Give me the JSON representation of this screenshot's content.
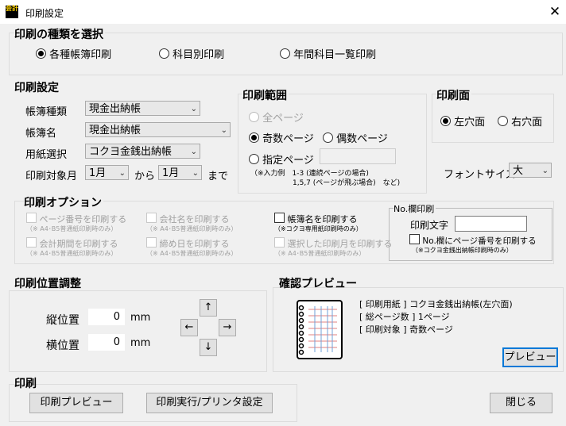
{
  "window": {
    "title": "印刷設定",
    "close": "✕",
    "icon_text": "会計"
  },
  "print_type": {
    "header": "印刷の種類を選択",
    "options": [
      "各種帳簿印刷",
      "科目別印刷",
      "年間科目一覧印刷"
    ],
    "selected": 0
  },
  "settings": {
    "header": "印刷設定",
    "ledger_type_label": "帳簿種類",
    "ledger_type_value": "現金出納帳",
    "ledger_name_label": "帳簿名",
    "ledger_name_value": "現金出納帳",
    "paper_label": "用紙選択",
    "paper_value": "コクヨ金銭出納帳",
    "month_label": "印刷対象月",
    "month_from": "1月",
    "from_label": "から",
    "month_to": "1月",
    "to_label": "まで"
  },
  "range": {
    "header": "印刷範囲",
    "all_pages": "全ページ",
    "odd_pages": "奇数ページ",
    "even_pages": "偶数ページ",
    "specified_pages": "指定ページ",
    "example_line1": "（※入力例　1-3 (連続ページの場合)",
    "example_line2": "1,5,7 (ページが飛ぶ場合)　など)",
    "specified_value": ""
  },
  "side": {
    "header": "印刷面",
    "left": "左穴面",
    "right": "右穴面"
  },
  "font": {
    "label": "フォントサイズ",
    "value": "大"
  },
  "options": {
    "header": "印刷オプション",
    "page_number": "ページ番号を印刷する",
    "page_number_note": "（※ A4･B5普通紙印刷時のみ）",
    "company_name": "会社名を印刷する",
    "company_name_note": "（※ A4･B5普通紙印刷時のみ）",
    "ledger_name": "帳簿名を印刷する",
    "ledger_name_note": "（※コクヨ専用紙印刷時のみ）",
    "fiscal_period": "会計期間を印刷する",
    "fiscal_period_note": "（※ A4･B5普通紙印刷時のみ）",
    "closing_date": "締め日を印刷する",
    "closing_date_note": "（※ A4･B5普通紙印刷時のみ）",
    "selected_month": "選択した印刷月を印刷する",
    "selected_month_note": "（※ A4･B5普通紙印刷時のみ）"
  },
  "no_field": {
    "header": "No.欄印刷",
    "text_label": "印刷文字",
    "text_value": "",
    "checkbox": "No.欄にページ番号を印刷する",
    "note": "（※コクヨ金銭出納帳印刷時のみ）"
  },
  "position": {
    "header": "印刷位置調整",
    "vertical_label": "縦位置",
    "vertical_value": "0",
    "horizontal_label": "横位置",
    "horizontal_value": "0",
    "unit": "mm",
    "up": "↑",
    "left": "←",
    "right": "→",
    "down": "↓"
  },
  "preview": {
    "header": "確認プレビュー",
    "line1": "[ 印刷用紙 ] コクヨ金銭出納帳(左穴面)",
    "line2": "[ 総ページ数 ] 1ページ",
    "line3": "[ 印刷対象 ] 奇数ページ",
    "button": "プレビュー"
  },
  "print": {
    "header": "印刷",
    "preview_button": "印刷プレビュー",
    "execute_button": "印刷実行/プリンタ設定"
  },
  "close_button": "閉じる"
}
